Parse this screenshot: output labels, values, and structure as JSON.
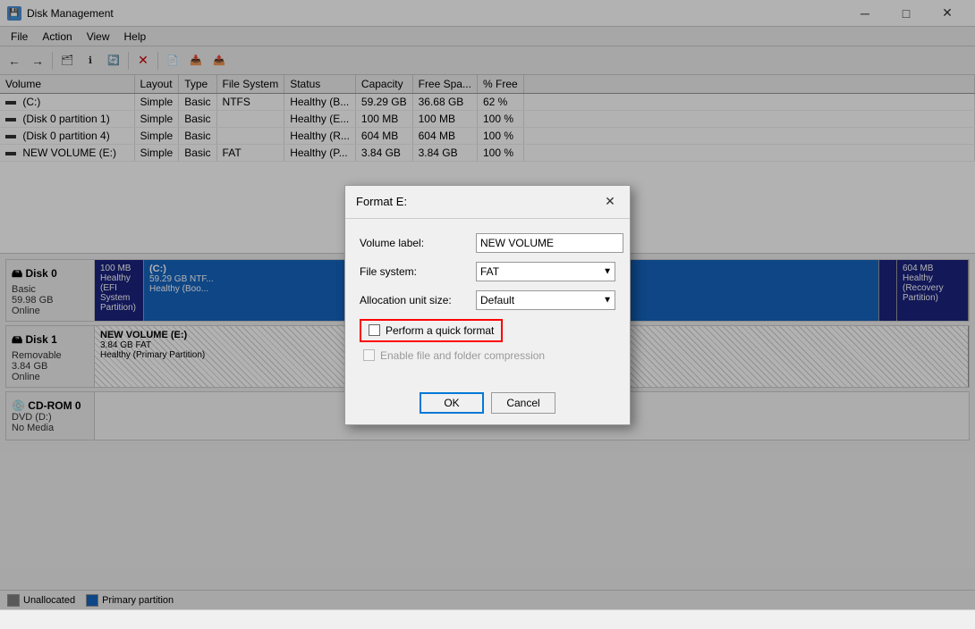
{
  "titleBar": {
    "title": "Disk Management",
    "icon": "💾"
  },
  "menuBar": {
    "items": [
      "File",
      "Action",
      "View",
      "Help"
    ]
  },
  "toolbar": {
    "buttons": [
      {
        "id": "back",
        "icon": "←",
        "disabled": false
      },
      {
        "id": "forward",
        "icon": "→",
        "disabled": false
      },
      {
        "id": "up",
        "icon": "⬆",
        "disabled": false
      },
      {
        "id": "map",
        "icon": "🗺",
        "disabled": false
      },
      {
        "id": "settings",
        "icon": "⚙",
        "disabled": false
      },
      {
        "id": "delete",
        "icon": "✕",
        "disabled": false
      },
      {
        "id": "new",
        "icon": "📄",
        "disabled": false
      },
      {
        "id": "import",
        "icon": "📥",
        "disabled": false
      },
      {
        "id": "export",
        "icon": "📤",
        "disabled": false
      }
    ]
  },
  "table": {
    "columns": [
      "Volume",
      "Layout",
      "Type",
      "File System",
      "Status",
      "Capacity",
      "Free Spa...",
      "% Free"
    ],
    "rows": [
      {
        "volume": "(C:)",
        "layout": "Simple",
        "type": "Basic",
        "fs": "NTFS",
        "status": "Healthy (B...",
        "capacity": "59.29 GB",
        "free": "36.68 GB",
        "pctFree": "62 %"
      },
      {
        "volume": "(Disk 0 partition 1)",
        "layout": "Simple",
        "type": "Basic",
        "fs": "",
        "status": "Healthy (E...",
        "capacity": "100 MB",
        "free": "100 MB",
        "pctFree": "100 %"
      },
      {
        "volume": "(Disk 0 partition 4)",
        "layout": "Simple",
        "type": "Basic",
        "fs": "",
        "status": "Healthy (R...",
        "capacity": "604 MB",
        "free": "604 MB",
        "pctFree": "100 %"
      },
      {
        "volume": "NEW VOLUME (E:)",
        "layout": "Simple",
        "type": "Basic",
        "fs": "FAT",
        "status": "Healthy (P...",
        "capacity": "3.84 GB",
        "free": "3.84 GB",
        "pctFree": "100 %"
      }
    ]
  },
  "diskPanel": {
    "disks": [
      {
        "id": "disk0",
        "label": "Disk 0",
        "type": "Basic",
        "size": "59.98 GB",
        "status": "Online",
        "partitions": [
          {
            "name": "",
            "size": "100 MB",
            "status": "Healthy (EFI System Partition)",
            "style": "dark-blue",
            "width": "3%"
          },
          {
            "name": "(C:)",
            "size": "59.29 GB NTFS",
            "status": "Healthy (Boo...",
            "style": "medium-blue",
            "width": "88%"
          },
          {
            "name": "",
            "size": "",
            "status": "",
            "style": "dark-blue-right",
            "width": "2%"
          },
          {
            "name": "",
            "size": "604 MB",
            "status": "Healthy (Recovery Partition)",
            "style": "dark-blue",
            "width": "7%"
          }
        ]
      },
      {
        "id": "disk1",
        "label": "Disk 1",
        "type": "Removable",
        "size": "3.84 GB",
        "status": "Online",
        "partitions": [
          {
            "name": "NEW VOLUME (E:)",
            "size": "3.84 GB FAT",
            "status": "Healthy (Primary Partition)",
            "style": "striped",
            "width": "100%"
          }
        ]
      },
      {
        "id": "cdrom0",
        "label": "CD-ROM 0",
        "type": "DVD (D:)",
        "size": "",
        "status": "No Media",
        "partitions": []
      }
    ]
  },
  "legend": {
    "items": [
      {
        "label": "Unallocated",
        "style": "unalloc"
      },
      {
        "label": "Primary partition",
        "style": "primary"
      }
    ]
  },
  "dialog": {
    "title": "Format E:",
    "volumeLabel": "Volume label:",
    "volumeValue": "NEW VOLUME",
    "fileSystemLabel": "File system:",
    "fileSystemValue": "FAT",
    "allocationLabel": "Allocation unit size:",
    "allocationValue": "Default",
    "quickFormat": "Perform a quick format",
    "fileCompression": "Enable file and folder compression",
    "quickFormatChecked": false,
    "fileCompressionChecked": false,
    "fileCompressionDisabled": true,
    "okLabel": "OK",
    "cancelLabel": "Cancel"
  },
  "statusBar": {
    "text": ""
  }
}
